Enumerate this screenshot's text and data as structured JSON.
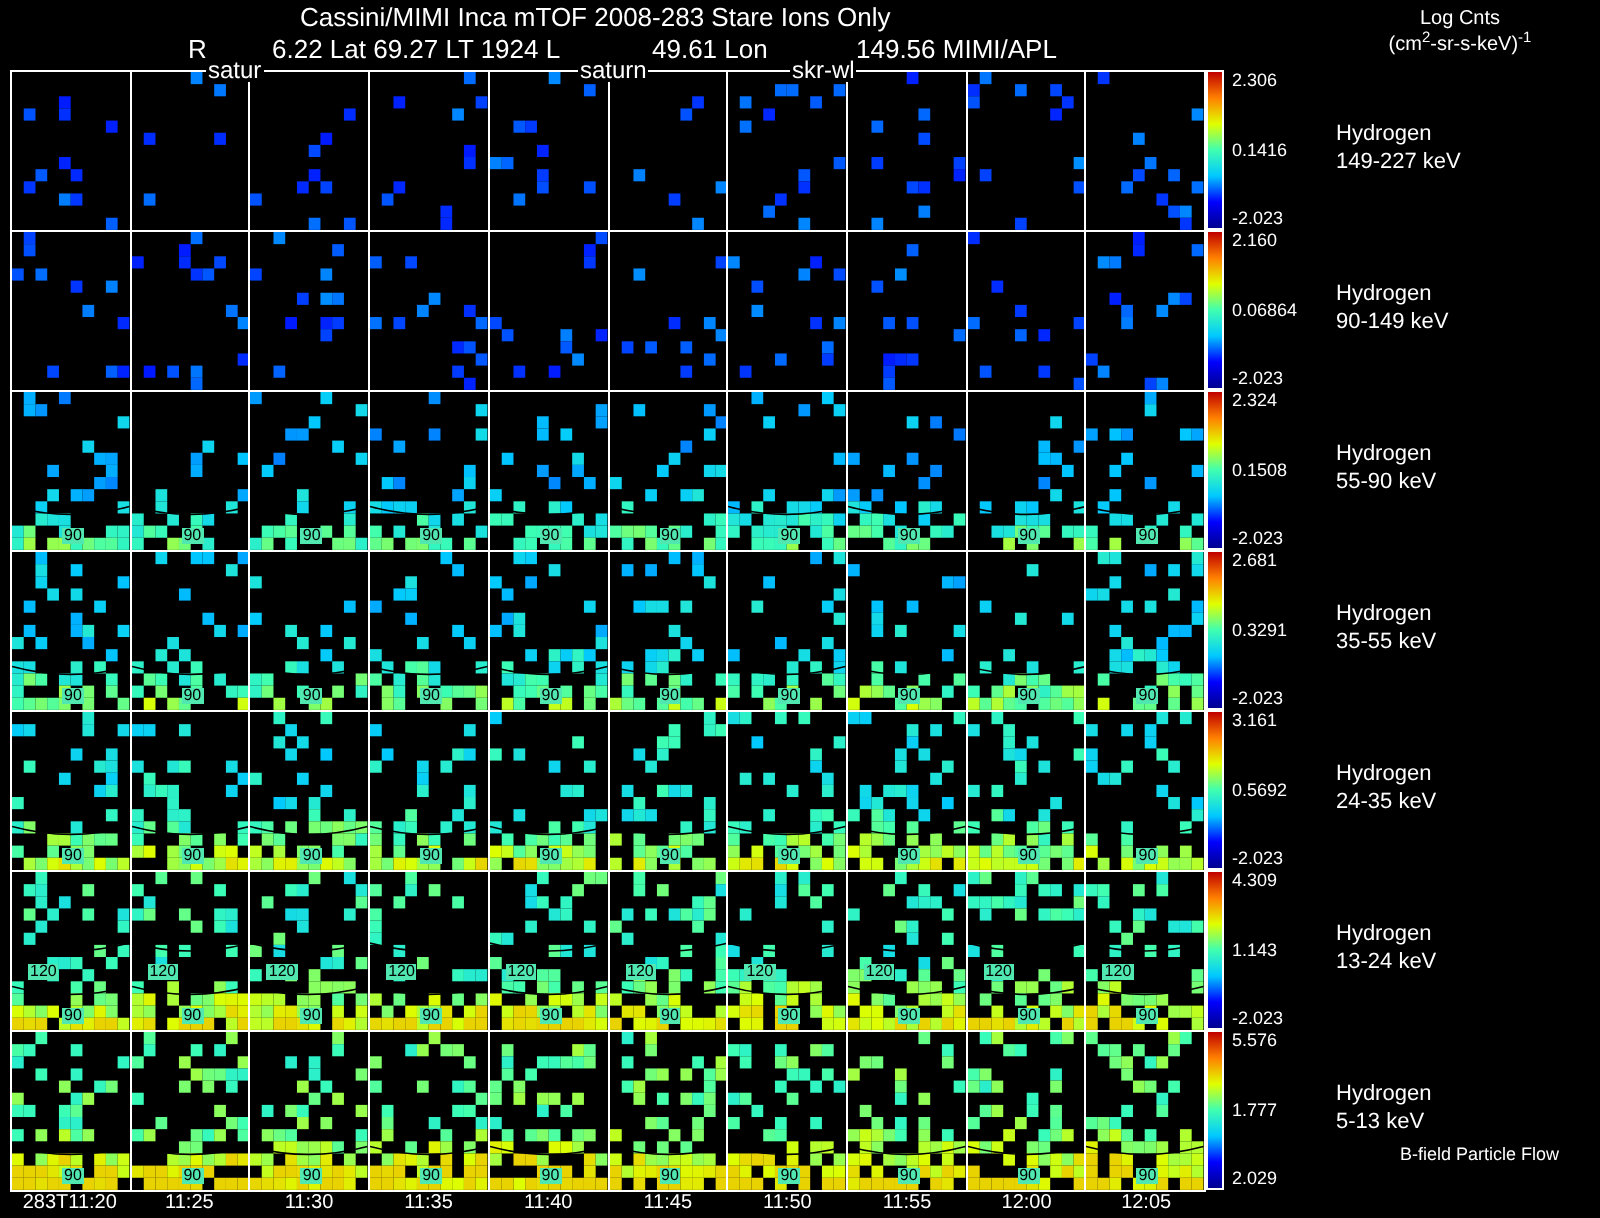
{
  "title": "Cassini/MIMI Inca mTOF  2008-283   Stare   Ions Only",
  "subtitle": [
    "R",
    "6.22 Lat 69.27 LT 1924 L",
    "49.61 Lon",
    "149.56  MIMI/APL"
  ],
  "overlay_labels": [
    "satur",
    "saturn",
    "skr-wl"
  ],
  "units": {
    "title": "Log Cnts",
    "unit": "(cm$^{2}$-sr-s-keV)$^{-1}$"
  },
  "rows": [
    {
      "species": "Hydrogen",
      "energy": "149-227 keV",
      "max": "2.306",
      "mid": "0.1416",
      "min": "-2.023"
    },
    {
      "species": "Hydrogen",
      "energy": "90-149 keV",
      "max": "2.160",
      "mid": "0.06864",
      "min": "-2.023"
    },
    {
      "species": "Hydrogen",
      "energy": "55-90 keV",
      "max": "2.324",
      "mid": "0.1508",
      "min": "-2.023",
      "contour_labels": [
        [
          "90"
        ],
        [
          "90"
        ],
        [
          "90"
        ],
        [
          "90"
        ],
        [
          "90"
        ],
        [
          "90"
        ],
        [
          "90"
        ],
        [
          "90"
        ],
        [
          "90"
        ],
        [
          "90"
        ]
      ]
    },
    {
      "species": "Hydrogen",
      "energy": "35-55 keV",
      "max": "2.681",
      "mid": "0.3291",
      "min": "-2.023",
      "contour_labels": [
        [
          "90"
        ],
        [
          "90"
        ],
        [
          "90"
        ],
        [
          "90"
        ],
        [
          "90"
        ],
        [
          "90"
        ],
        [
          "90"
        ],
        [
          "90"
        ],
        [
          "90"
        ],
        [
          "90"
        ]
      ]
    },
    {
      "species": "Hydrogen",
      "energy": "24-35 keV",
      "max": "3.161",
      "mid": "0.5692",
      "min": "-2.023",
      "contour_labels": [
        [
          "90"
        ],
        [
          "90"
        ],
        [
          "90"
        ],
        [
          "90"
        ],
        [
          "90"
        ],
        [
          "90"
        ],
        [
          "90"
        ],
        [
          "90"
        ],
        [
          "90"
        ],
        [
          "90"
        ]
      ]
    },
    {
      "species": "Hydrogen",
      "energy": "13-24 keV",
      "max": "4.309",
      "mid": "1.143",
      "min": "-2.023",
      "contour_labels": [
        [
          "120",
          "90"
        ],
        [
          "120",
          "90"
        ],
        [
          "120",
          "90"
        ],
        [
          "120",
          "90"
        ],
        [
          "120",
          "90"
        ],
        [
          "120",
          "90"
        ],
        [
          "120",
          "90"
        ],
        [
          "120",
          "90"
        ],
        [
          "120",
          "90"
        ],
        [
          "120",
          "90"
        ]
      ]
    },
    {
      "species": "Hydrogen",
      "energy": "5-13 keV",
      "max": "5.576",
      "mid": "1.777",
      "min": "2.029",
      "contour_labels": [
        [
          "90"
        ],
        [
          "90"
        ],
        [
          "90"
        ],
        [
          "90"
        ],
        [
          "90"
        ],
        [
          "90"
        ],
        [
          "90"
        ],
        [
          "90"
        ],
        [
          "90"
        ],
        [
          "90"
        ]
      ]
    }
  ],
  "legend_note": "B-field Particle Flow",
  "times": [
    "283T11:20",
    "11:25",
    "11:30",
    "11:35",
    "11:40",
    "11:45",
    "11:50",
    "11:55",
    "12:00",
    "12:05"
  ]
}
